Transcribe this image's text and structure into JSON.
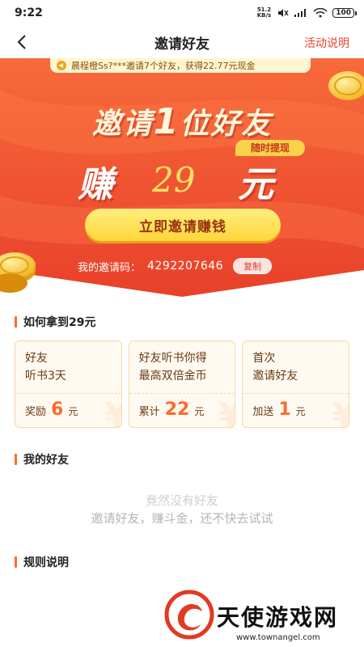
{
  "status_bar": {
    "time": "9:22",
    "net_speed_value": "51.2",
    "net_speed_unit": "KB/s",
    "battery": "100"
  },
  "nav": {
    "back_icon": "chevron-left-icon",
    "title": "邀请好友",
    "action": "活动说明"
  },
  "hero": {
    "ticker_text": "晨程橙Ss?***邀请7个好友，获得22.77元现金",
    "headline_prefix": "邀请",
    "headline_number": "1",
    "headline_suffix": "位好友",
    "tag": "随时提现",
    "earn_word": "赚",
    "earn_amount": "29",
    "earn_unit": "元",
    "invite_button": "立即邀请赚钱",
    "code_label": "我的邀请码：",
    "code_value": "4292207646",
    "copy_button": "复制",
    "colors": {
      "background_top": "#f76a3b",
      "background_bottom": "#e8412a",
      "button": "#ffd63a"
    }
  },
  "how_to": {
    "title": "如何拿到29元",
    "cards": [
      {
        "line1": "好友",
        "line2": "听书3天",
        "prefix": "奖励",
        "amount": "6",
        "unit": "元"
      },
      {
        "line1": "好友听书你得",
        "line2": "最高双倍金币",
        "prefix": "累计",
        "amount": "22",
        "unit": "元"
      },
      {
        "line1": "首次",
        "line2": "邀请好友",
        "prefix": "加送",
        "amount": "1",
        "unit": "元"
      }
    ]
  },
  "friends": {
    "title": "我的好友",
    "empty_line1": "竟然没有好友",
    "empty_line2": "邀请好友，赚斗金，还不快去试试"
  },
  "rules": {
    "title": "规则说明"
  },
  "watermark": {
    "text": "天使游戏网",
    "url": "www.townangel.com"
  }
}
